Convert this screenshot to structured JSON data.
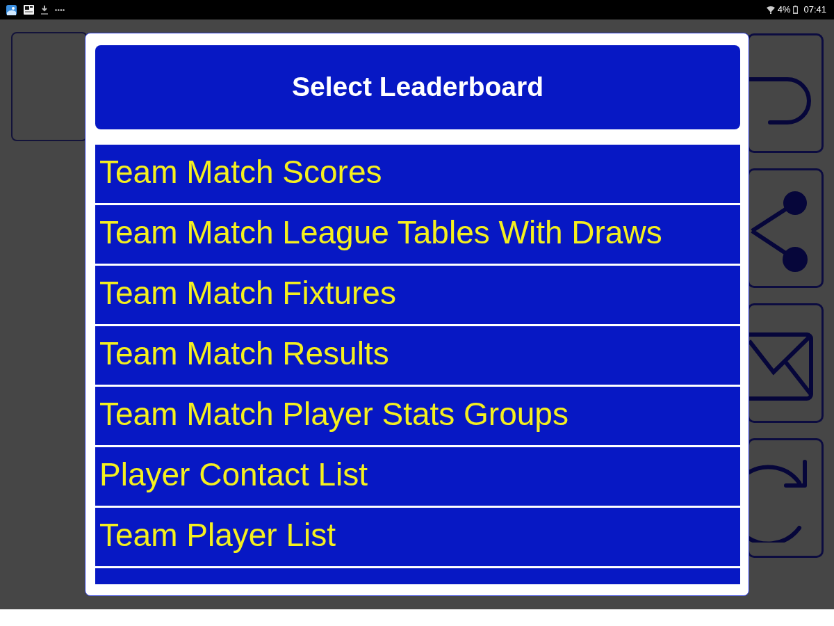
{
  "status_bar": {
    "battery": "4%",
    "time": "07:41"
  },
  "dialog": {
    "title": "Select Leaderboard",
    "items": [
      "Team Match Scores",
      "Team Match League Tables With Draws",
      "Team Match Fixtures",
      "Team Match Results",
      "Team Match Player Stats Groups",
      "Player Contact List",
      "Team Player List"
    ]
  }
}
